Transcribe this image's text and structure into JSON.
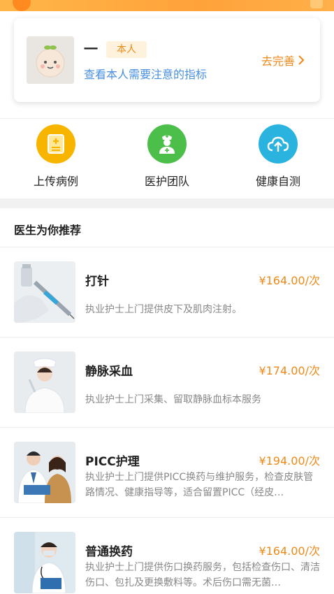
{
  "profile": {
    "name_placeholder": "一",
    "badge": "本人",
    "description": "查看本人需要注意的指标",
    "action_label": "去完善",
    "action_chevron": "›"
  },
  "quick_actions": [
    {
      "label": "上传病例",
      "icon": "document-plus-icon",
      "color": "#f7b500"
    },
    {
      "label": "医护团队",
      "icon": "nurse-icon",
      "color": "#4cbf4a"
    },
    {
      "label": "健康自测",
      "icon": "cloud-upload-icon",
      "color": "#2bb3e0"
    }
  ],
  "recommend": {
    "title": "医生为你推荐",
    "items": [
      {
        "name": "打针",
        "price": "¥164.00/次",
        "desc": "执业护士上门提供皮下及肌肉注射。"
      },
      {
        "name": "静脉采血",
        "price": "¥174.00/次",
        "desc": "执业护士上门采集、留取静脉血标本服务"
      },
      {
        "name": "PICC护理",
        "price": "¥194.00/次",
        "desc": "执业护士上门提供PICC换药与维护服务，检查皮肤管路情况、健康指导等，适合留置PICC（经皮…"
      },
      {
        "name": "普通换药",
        "price": "¥164.00/次",
        "desc": "执业护士上门提供伤口换药服务，包括检查伤口、清洁伤口、包扎及更换敷料等。术后伤口需无菌…"
      }
    ]
  },
  "colors": {
    "accent": "#ee8a1a",
    "link": "#4a90e2"
  }
}
